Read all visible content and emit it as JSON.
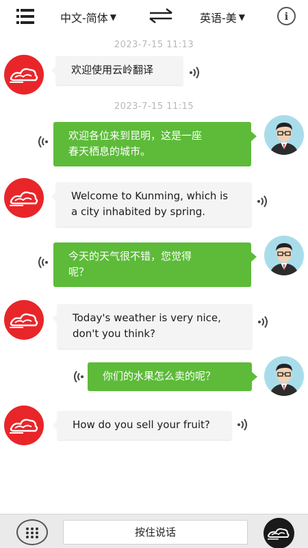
{
  "header": {
    "source_language": "中文-简体",
    "target_language": "英语-美",
    "dropdown_glyph": "▼",
    "menu_icon": "menu-icon",
    "swap_icon": "swap-arrows-icon",
    "info_icon": "info-icon",
    "info_glyph": "i"
  },
  "colors": {
    "bot_avatar": "#e8262a",
    "user_bubble": "#5dbb39",
    "bot_bubble": "#f4f4f4",
    "timestamp": "#b8b8b8"
  },
  "conversation": {
    "timestamps": [
      "2023-7-15  11:13",
      "2023-7-15  11:15"
    ],
    "messages": [
      {
        "sender": "bot",
        "lines": [
          "欢迎使用云岭翻译"
        ]
      },
      {
        "sender": "user",
        "lines": [
          "欢迎各位来到昆明，这是一座",
          "春天栖息的城市。"
        ]
      },
      {
        "sender": "bot",
        "lines": [
          "Welcome to Kunming, which is",
          "a city inhabited by spring."
        ]
      },
      {
        "sender": "user",
        "lines": [
          "今天的天气很不错，您觉得",
          "呢？"
        ]
      },
      {
        "sender": "bot",
        "lines": [
          "Today's weather is very nice,",
          "don't you think?"
        ]
      },
      {
        "sender": "user",
        "lines": [
          "你们的水果怎么卖的呢？"
        ]
      },
      {
        "sender": "bot",
        "lines": [
          "How do you sell your fruit?"
        ]
      }
    ]
  },
  "footer": {
    "talk_button_label": "按住说话",
    "keypad_icon": "keypad-icon",
    "logo_icon": "cloud-logo-icon"
  }
}
